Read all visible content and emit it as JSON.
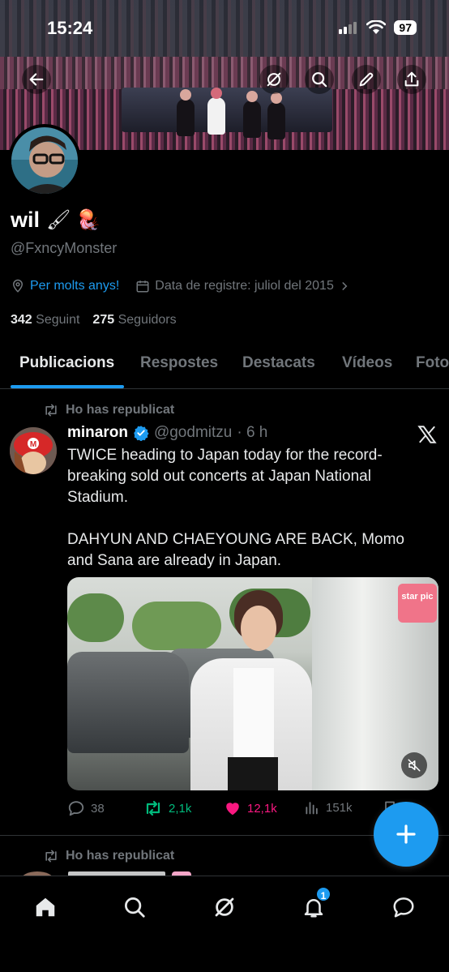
{
  "status_bar": {
    "time": "15:24",
    "battery": "97"
  },
  "profile": {
    "name": "wil",
    "name_emojis": "🖌 🪼",
    "handle": "@FxncyMonster",
    "location": "Per molts anys!",
    "joined": "Data de registre: juliol del 2015",
    "following_count": "342",
    "following_label": "Seguint",
    "followers_count": "275",
    "followers_label": "Seguidors"
  },
  "tabs": [
    "Publicacions",
    "Respostes",
    "Destacats",
    "Vídeos",
    "Fotos"
  ],
  "post": {
    "repost_label": "Ho has republicat",
    "author_name": "minaron",
    "author_handle": "@godmitzu",
    "time": "· 6 h",
    "text": "TWICE heading to Japan today for the record-breaking sold out concerts at Japan National Stadium.\n\nDAHYUN AND CHAEYOUNG ARE BACK, Momo and Sana are already in Japan.",
    "media_watermark": "star pic",
    "replies": "38",
    "reposts": "2,1k",
    "likes": "12,1k",
    "views": "151k"
  },
  "next_post": {
    "repost_label": "Ho has republicat"
  },
  "nav": {
    "notifications_badge": "1"
  },
  "colors": {
    "accent": "#1d9bf0",
    "like": "#f91880",
    "repost": "#00ba7c",
    "muted": "#71767b"
  }
}
